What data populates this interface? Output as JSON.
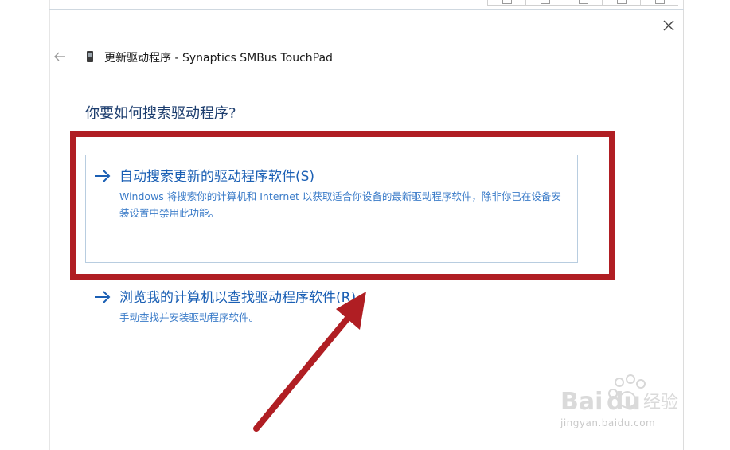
{
  "window": {
    "title": "更新驱动程序 - Synaptics SMBus TouchPad",
    "back_icon": "back-arrow-icon",
    "close_icon": "close-icon",
    "device_icon": "device-icon"
  },
  "prompt": {
    "question": "你要如何搜索驱动程序?"
  },
  "options": [
    {
      "title": "自动搜索更新的驱动程序软件(S)",
      "description": "Windows 将搜索你的计算机和 Internet 以获取适合你设备的最新驱动程序软件，除非你已在设备安装设置中禁用此功能。",
      "icon": "arrow-right-icon"
    },
    {
      "title": "浏览我的计算机以查找驱动程序软件(R)",
      "description": "手动查找并安装驱动程序软件。",
      "icon": "arrow-right-icon"
    }
  ],
  "annotation": {
    "highlight_color": "#b01e23",
    "arrow_color": "#b01e23"
  },
  "watermark": {
    "logo": "Bai 经验",
    "url": "jingyan.baidu.com"
  },
  "colors": {
    "link_blue": "#1a5fb4",
    "desc_blue": "#3a7bc8",
    "heading_blue": "#1c3d6e",
    "box_border": "#b8cde0"
  }
}
